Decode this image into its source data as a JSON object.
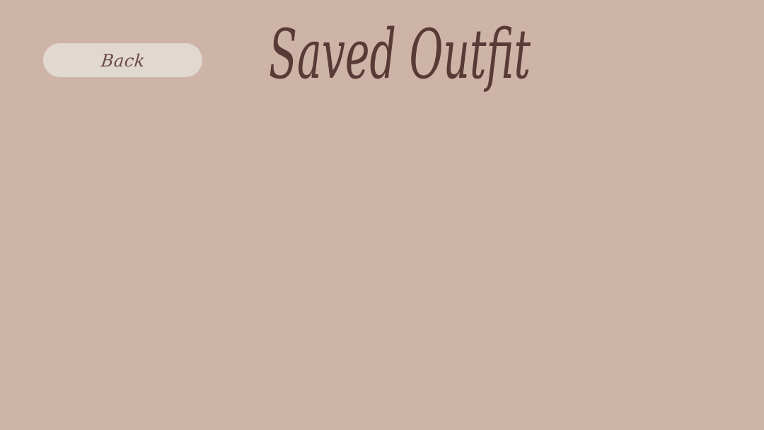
{
  "page": {
    "title": "Saved Outfit",
    "back_label": "Back"
  },
  "theme": {
    "background": "#ceb4a7",
    "button_background": "#e2d8d2",
    "text_color": "#5a3a36"
  }
}
